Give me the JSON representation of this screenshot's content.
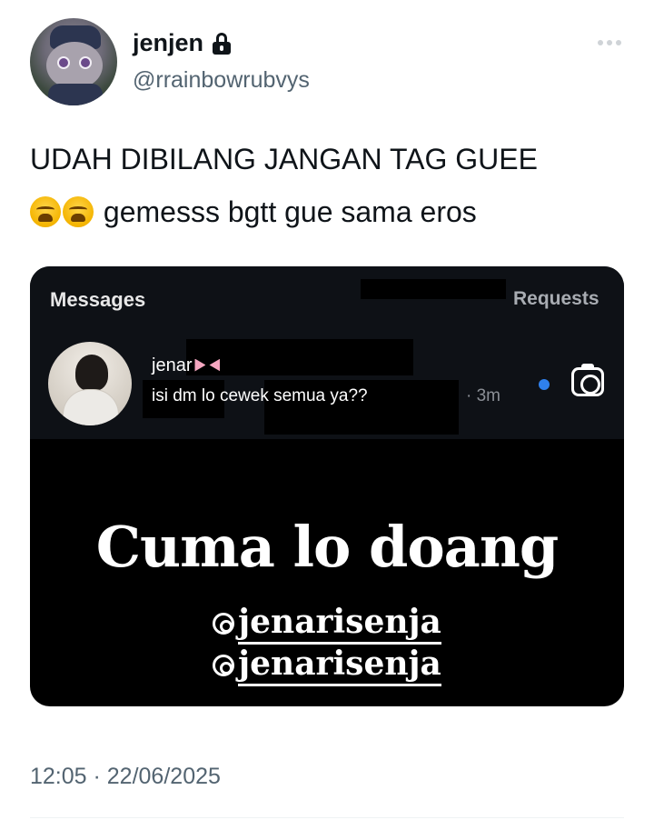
{
  "tweet": {
    "display_name": "jenjen",
    "username": "@rrainbowrubvys",
    "text_line1": "UDAH DIBILANG JANGAN TAG GUEE",
    "text_line2": "gemesss bgtt gue sama eros",
    "emojis": [
      "tired-face-emoji",
      "tired-face-emoji"
    ],
    "timestamp": "12:05 · 22/06/2025"
  },
  "media": {
    "dm_header": {
      "title": "Messages",
      "requests_label": "Requests"
    },
    "dm_thread": {
      "name": "jenar",
      "message": "isi dm lo cewek semua ya??",
      "time": "· 3m"
    },
    "caption": "Cuma lo doang",
    "mentions": [
      "jenarisenja",
      "jenarisenja"
    ]
  },
  "colors": {
    "text_primary": "#0f1419",
    "text_secondary": "#536471",
    "media_bg": "#000000",
    "dm_panel_bg": "#0e1116",
    "unread_dot": "#2f80ed"
  }
}
